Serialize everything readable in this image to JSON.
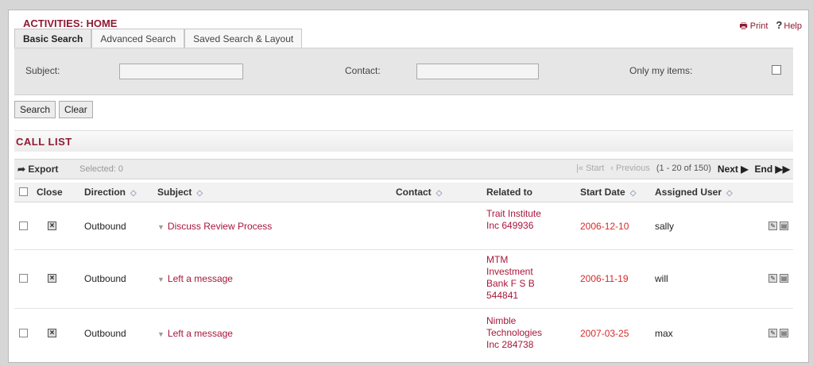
{
  "page": {
    "title": "ACTIVITIES: HOME"
  },
  "toplinks": {
    "print": "Print",
    "help": "Help"
  },
  "tabs": [
    "Basic Search",
    "Advanced Search",
    "Saved Search & Layout"
  ],
  "search": {
    "subject_label": "Subject:",
    "contact_label": "Contact:",
    "only_my_items_label": "Only my items:",
    "subject_value": "",
    "contact_value": ""
  },
  "buttons": {
    "search": "Search",
    "clear": "Clear"
  },
  "list": {
    "title": "CALL LIST",
    "export": "Export",
    "selected": "Selected: 0",
    "start": "Start",
    "previous": "Previous",
    "range": "(1 - 20 of 150)",
    "next": "Next",
    "end": "End"
  },
  "columns": {
    "close": "Close",
    "direction": "Direction",
    "subject": "Subject",
    "contact": "Contact",
    "related_to": "Related to",
    "start_date": "Start Date",
    "assigned_user": "Assigned User"
  },
  "rows": [
    {
      "direction": "Outbound",
      "subject": "Discuss Review Process",
      "contact": "",
      "related": [
        "Trait Institute",
        "Inc 649936"
      ],
      "date": "2006-12-10",
      "user": "sally"
    },
    {
      "direction": "Outbound",
      "subject": "Left a message",
      "contact": "",
      "related": [
        "MTM",
        "Investment",
        "Bank F S B",
        "544841"
      ],
      "date": "2006-11-19",
      "user": "will"
    },
    {
      "direction": "Outbound",
      "subject": "Left a message",
      "contact": "",
      "related": [
        "Nimble",
        "Technologies",
        "Inc 284738"
      ],
      "date": "2007-03-25",
      "user": "max"
    }
  ],
  "colors": {
    "accent": "#8e1a32",
    "link": "#a8163b",
    "date": "#d42b2b"
  }
}
